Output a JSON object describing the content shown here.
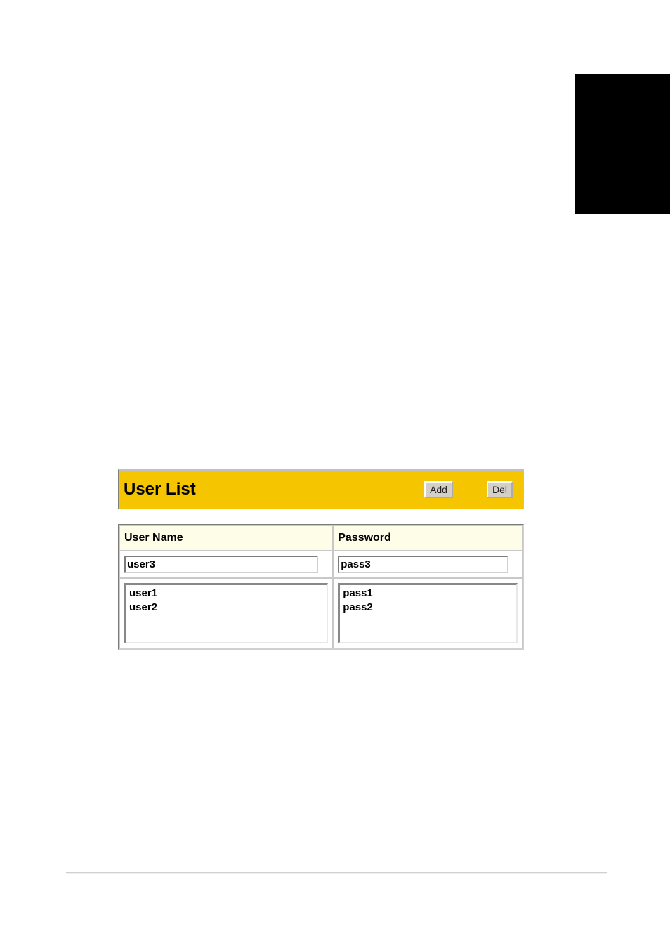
{
  "title_bar": {
    "title": "User List",
    "add_label": "Add",
    "del_label": "Del"
  },
  "headers": {
    "username": "User Name",
    "password": "Password"
  },
  "inputs": {
    "username_value": "user3",
    "password_value": "pass3"
  },
  "list": {
    "users": [
      {
        "username": "user1",
        "password": "pass1"
      },
      {
        "username": "user2",
        "password": "pass2"
      }
    ]
  }
}
